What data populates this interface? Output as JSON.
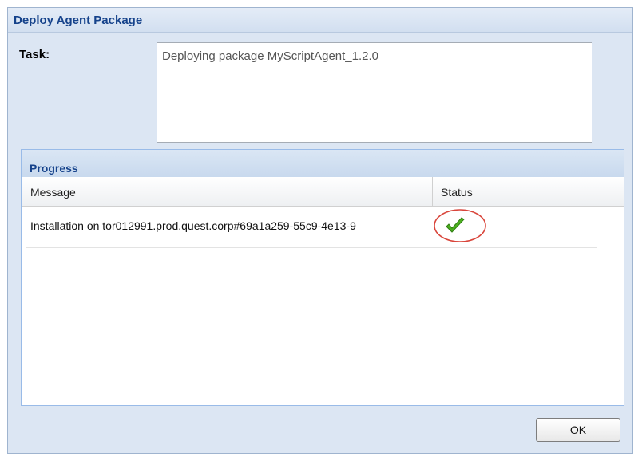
{
  "dialog": {
    "title": "Deploy Agent Package",
    "task_label": "Task:",
    "task_text": "Deploying package MyScriptAgent_1.2.0"
  },
  "progress": {
    "title": "Progress",
    "columns": [
      "Message",
      "Status"
    ],
    "rows": [
      {
        "message": "Installation on tor012991.prod.quest.corp#69a1a259-55c9-4e13-9",
        "status_icon": "check-icon",
        "status_color": "#4caf1e"
      }
    ]
  },
  "buttons": {
    "ok_label": "OK"
  },
  "colors": {
    "title_text": "#15428b",
    "dialog_bg": "#dce6f3",
    "highlight_ring": "#d9453b"
  }
}
